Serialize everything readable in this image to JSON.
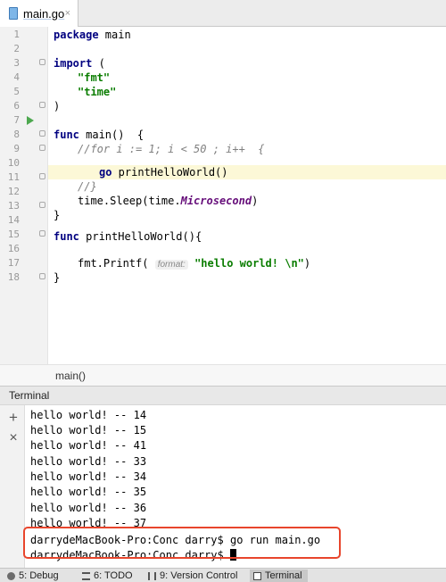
{
  "tab": {
    "filename": "main.go",
    "close_glyph": "×"
  },
  "editor": {
    "line_numbers": [
      "1",
      "2",
      "3",
      "4",
      "5",
      "6",
      "7",
      "8",
      "9",
      "10",
      "11",
      "12",
      "13",
      "14",
      "15",
      "16",
      "17",
      "18"
    ],
    "lines": {
      "l1_kw": "package",
      "l1_rest": " main",
      "l3_kw": "import",
      "l3_rest": " (",
      "l4_str": "\"fmt\"",
      "l5_str": "\"time\"",
      "l6": ")",
      "l8_kw": "func",
      "l8_rest": " main()  {",
      "l9_cmt": "//for i := 1; i < 50 ; i++  {",
      "l10_kw": "go",
      "l10_rest": " printHelloWorld()",
      "l11_cmt": "//}",
      "l12_pre": "time.Sleep(time.",
      "l12_it": "Microsecond",
      "l12_post": ")",
      "l13": "}",
      "l15_kw": "func",
      "l15_rest": " printHelloWorld(){",
      "l17_pre": "fmt.Printf(",
      "l17_hint": "format:",
      "l17_str": "\"hello world! \\n\"",
      "l17_post": ")",
      "l18": "}"
    },
    "breadcrumb": "main()"
  },
  "terminal": {
    "title": "Terminal",
    "add_glyph": "+",
    "close_glyph": "×",
    "output": [
      "hello world! -- 14",
      "hello world! -- 15",
      "hello world! -- 41",
      "hello world! -- 33",
      "hello world! -- 34",
      "hello world! -- 35",
      "hello world! -- 36",
      "hello world! -- 37"
    ],
    "prompt_line_1": "darrydeMacBook-Pro:Conc darry$ go run main.go",
    "prompt_line_2": "darrydeMacBook-Pro:Conc darry$ "
  },
  "statusbar": {
    "debug": "5: Debug",
    "todo": "6: TODO",
    "vcs": "9: Version Control",
    "terminal": "Terminal"
  },
  "colors": {
    "highlight_box": "#e8452c",
    "run_arrow": "#4da84f",
    "current_line": "#fcf8d7"
  }
}
